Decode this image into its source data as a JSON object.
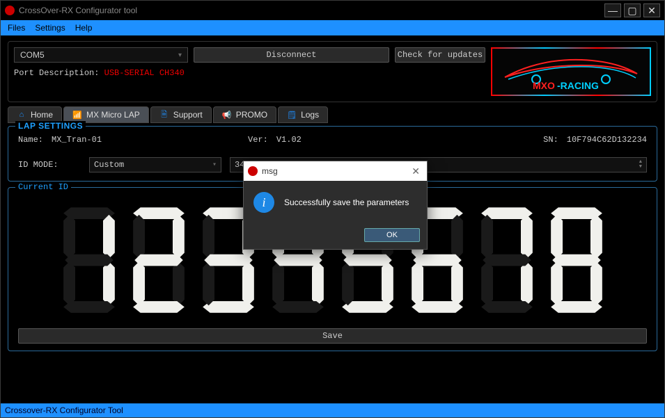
{
  "window": {
    "title": "CrossOver-RX Configurator tool"
  },
  "menu": {
    "files": "Files",
    "settings": "Settings",
    "help": "Help"
  },
  "conn": {
    "port": "COM5",
    "disconnect": "Disconnect",
    "check": "Check for updates",
    "port_desc_label": "Port Description:",
    "port_desc_value": "USB-SERIAL CH340"
  },
  "logo": {
    "brand_mxo": "MXO",
    "brand_racing": "-RACING"
  },
  "tabs": {
    "home": "Home",
    "microlap": "MX Micro LAP",
    "support": "Support",
    "promo": "PROMO",
    "logs": "Logs"
  },
  "lap": {
    "legend": "LAP SETTINGS",
    "name_label": "Name:",
    "name_value": "MX_Tran-01",
    "ver_label": "Ver:",
    "ver_value": "V1.02",
    "sn_label": "SN:",
    "sn_value": "10F794C62D132234",
    "idmode_label": "ID MODE:",
    "idmode_value": "Custom",
    "custom_value": "345678"
  },
  "current": {
    "legend": "Current ID",
    "digits": "12345678",
    "save": "Save"
  },
  "dialog": {
    "title": "msg",
    "text": "Successfully save the parameters",
    "ok": "OK",
    "info_glyph": "i"
  },
  "status": {
    "text": "Crossover-RX Configurator Tool"
  }
}
